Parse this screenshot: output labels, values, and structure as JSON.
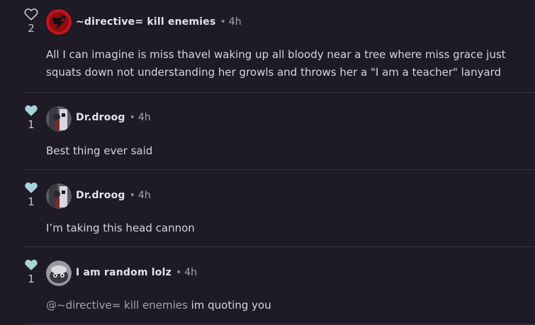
{
  "colors": {
    "background": "#1e1a26",
    "heart_outline": "#c9c5d0",
    "heart_filled": "#a9d3d8",
    "divider": "#3a3542"
  },
  "comments": [
    {
      "likes": "2",
      "liked": false,
      "author": "~directive= kill enemies",
      "separator": "•",
      "time": "4h",
      "text": "All I can imagine is miss thavel waking up all bloody near a tree where miss grace just squats down not understanding her growls and throws her a \"I am a teacher\" lanyard",
      "avatar": "red-logo-avatar"
    },
    {
      "likes": "1",
      "liked": true,
      "author": "Dr.droog",
      "separator": "•",
      "time": "4h",
      "text": "Best thing ever said",
      "avatar": "character-avatar"
    },
    {
      "likes": "1",
      "liked": true,
      "author": "Dr.droog",
      "separator": "•",
      "time": "4h",
      "text": "I’m taking this head cannon",
      "avatar": "character-avatar"
    },
    {
      "likes": "1",
      "liked": true,
      "author": "I am random lolz",
      "separator": "•",
      "time": "4h",
      "mention": "@~directive= kill enemies",
      "text": " im quoting you",
      "avatar": "grey-creature-avatar"
    }
  ]
}
